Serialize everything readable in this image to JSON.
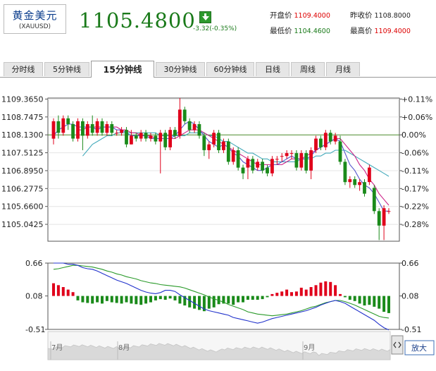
{
  "header": {
    "name": "黄金美元",
    "code": "(XAUUSD)",
    "price": "1105.4800",
    "change": "-3.32(-0.35%)",
    "stats": [
      {
        "label": "开盘价",
        "value": "1109.4000",
        "color": "#dd0000"
      },
      {
        "label": "昨收价",
        "value": "1108.8000",
        "color": "#222222"
      },
      {
        "label": "最低价",
        "value": "1104.4600",
        "color": "#1a7a1a"
      },
      {
        "label": "最高价",
        "value": "1109.4000",
        "color": "#dd0000"
      }
    ]
  },
  "tabs": [
    "分时线",
    "5分钟线",
    "15分钟线",
    "30分钟线",
    "60分钟线",
    "日线",
    "周线",
    "月线"
  ],
  "active_tab": "15分钟线",
  "colors": {
    "up": "#e0001b",
    "down": "#1a8a1a",
    "ma5": "#5555cc",
    "ma10": "#cc2288",
    "ma20": "#44aabb"
  },
  "chart_data": {
    "type": "candlestick",
    "y_ticks_left": [
      "1109.3650",
      "1108.7475",
      "1108.1300",
      "1107.5125",
      "1106.8950",
      "1106.2775",
      "1105.6600",
      "1105.0425"
    ],
    "y_ticks_right": [
      "+0.11%",
      "+0.06%",
      "0.00%",
      "-0.06%",
      "-0.11%",
      "-0.17%",
      "-0.22%",
      "-0.28%"
    ],
    "prev_close": 1108.13,
    "ylim": [
      1104.46,
      1109.4
    ],
    "candles": [
      [
        1108.0,
        1108.6,
        1108.7,
        1107.8
      ],
      [
        1108.6,
        1108.2,
        1108.8,
        1108.0
      ],
      [
        1108.2,
        1108.7,
        1108.8,
        1108.1
      ],
      [
        1108.7,
        1108.5,
        1108.8,
        1108.3
      ],
      [
        1108.5,
        1108.0,
        1108.6,
        1107.9
      ],
      [
        1108.0,
        1108.6,
        1108.7,
        1107.9
      ],
      [
        1108.6,
        1108.1,
        1108.7,
        1107.6
      ],
      [
        1108.1,
        1108.5,
        1108.6,
        1108.0
      ],
      [
        1108.5,
        1108.2,
        1108.8,
        1108.1
      ],
      [
        1108.2,
        1108.6,
        1108.7,
        1108.1
      ],
      [
        1108.6,
        1108.2,
        1108.7,
        1108.1
      ],
      [
        1108.2,
        1108.5,
        1108.6,
        1108.1
      ],
      [
        1108.5,
        1108.2,
        1108.6,
        1108.1
      ],
      [
        1108.2,
        1108.2,
        1108.3,
        1108.1
      ],
      [
        1108.2,
        1108.3,
        1108.4,
        1108.1
      ],
      [
        1108.3,
        1107.8,
        1108.4,
        1107.7
      ],
      [
        1107.8,
        1108.1,
        1108.3,
        1107.8
      ],
      [
        1108.1,
        1108.0,
        1108.2,
        1107.9
      ],
      [
        1108.0,
        1108.2,
        1108.3,
        1107.9
      ],
      [
        1108.2,
        1108.0,
        1108.3,
        1107.9
      ],
      [
        1108.0,
        1108.1,
        1108.2,
        1107.9
      ],
      [
        1108.1,
        1107.9,
        1108.2,
        1107.8
      ],
      [
        1107.9,
        1108.2,
        1108.3,
        1106.8
      ],
      [
        1108.2,
        1107.7,
        1108.3,
        1107.6
      ],
      [
        1107.7,
        1108.3,
        1108.4,
        1107.6
      ],
      [
        1108.3,
        1108.1,
        1108.4,
        1108.0
      ],
      [
        1108.1,
        1109.0,
        1109.4,
        1108.0
      ],
      [
        1109.0,
        1108.6,
        1109.1,
        1108.5
      ],
      [
        1108.6,
        1108.3,
        1108.7,
        1108.2
      ],
      [
        1108.3,
        1108.5,
        1108.6,
        1108.2
      ],
      [
        1108.5,
        1108.1,
        1108.6,
        1108.0
      ],
      [
        1108.1,
        1107.6,
        1108.2,
        1107.4
      ],
      [
        1107.6,
        1107.8,
        1107.9,
        1107.3
      ],
      [
        1107.8,
        1108.2,
        1108.3,
        1107.7
      ],
      [
        1108.2,
        1107.6,
        1108.3,
        1107.5
      ],
      [
        1107.6,
        1107.9,
        1108.0,
        1107.5
      ],
      [
        1107.9,
        1107.2,
        1108.0,
        1107.1
      ],
      [
        1107.2,
        1107.6,
        1107.7,
        1107.1
      ],
      [
        1107.6,
        1107.0,
        1107.7,
        1106.9
      ],
      [
        1107.0,
        1106.8,
        1107.1,
        1106.6
      ],
      [
        1107.0,
        1107.3,
        1107.4,
        1106.6
      ],
      [
        1107.3,
        1106.9,
        1107.4,
        1106.8
      ],
      [
        1107.0,
        1107.2,
        1107.3,
        1106.9
      ],
      [
        1107.2,
        1106.9,
        1107.3,
        1106.8
      ],
      [
        1107.0,
        1106.8,
        1107.1,
        1106.7
      ],
      [
        1106.8,
        1107.3,
        1107.4,
        1106.7
      ],
      [
        1107.3,
        1107.3,
        1107.4,
        1107.1
      ],
      [
        1107.4,
        1107.4,
        1107.5,
        1107.2
      ],
      [
        1107.4,
        1107.5,
        1107.6,
        1107.3
      ],
      [
        1107.5,
        1107.5,
        1107.6,
        1107.3
      ],
      [
        1107.5,
        1107.0,
        1107.6,
        1106.9
      ],
      [
        1107.0,
        1107.5,
        1107.6,
        1106.9
      ],
      [
        1107.5,
        1106.9,
        1107.6,
        1106.8
      ],
      [
        1106.9,
        1107.6,
        1107.7,
        1106.6
      ],
      [
        1107.6,
        1108.0,
        1108.1,
        1107.5
      ],
      [
        1108.0,
        1107.7,
        1108.1,
        1107.6
      ],
      [
        1107.7,
        1108.2,
        1108.3,
        1107.6
      ],
      [
        1108.2,
        1107.9,
        1108.3,
        1107.8
      ],
      [
        1107.9,
        1108.1,
        1108.2,
        1107.8
      ],
      [
        1107.9,
        1107.2,
        1108.1,
        1107.1
      ],
      [
        1107.2,
        1106.5,
        1107.3,
        1106.4
      ],
      [
        1106.5,
        1106.6,
        1106.7,
        1106.3
      ],
      [
        1106.6,
        1106.4,
        1106.7,
        1106.3
      ],
      [
        1106.4,
        1106.5,
        1106.6,
        1106.2
      ],
      [
        1106.5,
        1106.1,
        1106.6,
        1106.0
      ],
      [
        1106.5,
        1107.0,
        1107.1,
        1106.4
      ],
      [
        1106.3,
        1105.5,
        1106.4,
        1105.4
      ],
      [
        1105.5,
        1105.0,
        1105.6,
        1104.5
      ],
      [
        1105.0,
        1105.6,
        1105.7,
        1104.5
      ],
      [
        1105.5,
        1105.5,
        1105.6,
        1105.4
      ]
    ],
    "ma": {
      "ma5": [
        1108.1,
        1108.3,
        1108.4,
        1108.5,
        1108.5,
        1108.4,
        1108.4,
        1108.4,
        1108.4,
        1108.3,
        1108.4,
        1108.4,
        1108.4,
        1108.3,
        1108.3,
        1108.2,
        1108.1,
        1108.1,
        1108.1,
        1108.1,
        1108.0,
        1108.0,
        1108.0,
        1108.0,
        1108.0,
        1108.1,
        1108.3,
        1108.5,
        1108.6,
        1108.5,
        1108.3,
        1108.1,
        1107.9,
        1107.8,
        1107.7,
        1107.8,
        1107.7,
        1107.5,
        1107.4,
        1107.2,
        1107.1,
        1107.0,
        1106.9,
        1106.9,
        1107.0,
        1107.1,
        1107.1,
        1107.2,
        1107.3,
        1107.4,
        1107.3,
        1107.3,
        1107.3,
        1107.4,
        1107.6,
        1107.7,
        1107.8,
        1107.9,
        1108.0,
        1107.9,
        1107.5,
        1107.1,
        1106.9,
        1106.6,
        1106.4,
        1106.3,
        1106.1,
        1105.8,
        1105.5,
        1105.5
      ],
      "ma10": [
        null,
        null,
        null,
        null,
        null,
        1108.3,
        1108.3,
        1108.4,
        1108.4,
        1108.4,
        1108.4,
        1108.4,
        1108.4,
        1108.4,
        1108.3,
        1108.3,
        1108.2,
        1108.2,
        1108.1,
        1108.1,
        1108.1,
        1108.0,
        1108.0,
        1108.0,
        1108.0,
        1108.0,
        1108.1,
        1108.2,
        1108.3,
        1108.3,
        1108.3,
        1108.2,
        1108.1,
        1108.0,
        1107.9,
        1107.8,
        1107.7,
        1107.6,
        1107.5,
        1107.4,
        1107.3,
        1107.2,
        1107.1,
        1107.1,
        1107.1,
        1107.1,
        1107.1,
        1107.1,
        1107.2,
        1107.3,
        1107.3,
        1107.3,
        1107.4,
        1107.5,
        1107.6,
        1107.7,
        1107.8,
        1107.9,
        1108.0,
        1108.0,
        1107.8,
        1107.6,
        1107.4,
        1107.1,
        1106.9,
        1106.6,
        1106.4,
        1106.1,
        1105.9,
        1105.7
      ],
      "ma20": [
        null,
        null,
        null,
        null,
        null,
        null,
        1107.4,
        1107.6,
        1107.8,
        1107.9,
        1108.0,
        1108.1,
        1108.1,
        1108.2,
        1108.2,
        1108.2,
        1108.2,
        1108.2,
        1108.2,
        1108.2,
        1108.2,
        1108.2,
        1108.1,
        1108.1,
        1108.1,
        1108.1,
        1108.1,
        1108.1,
        1108.2,
        1108.2,
        1108.2,
        1108.2,
        1108.1,
        1108.1,
        1108.0,
        1107.9,
        1107.9,
        1107.8,
        1107.7,
        1107.6,
        1107.5,
        1107.5,
        1107.4,
        1107.3,
        1107.3,
        1107.2,
        1107.2,
        1107.2,
        1107.2,
        1107.2,
        1107.2,
        1107.3,
        1107.3,
        1107.3,
        1107.4,
        1107.4,
        1107.5,
        1107.5,
        1107.6,
        1107.6,
        1107.6,
        1107.5,
        1107.4,
        1107.3,
        1107.2,
        1107.1,
        1107.0,
        1106.9,
        1106.8,
        1106.7
      ]
    },
    "macd": {
      "y_ticks": [
        "0.66",
        "0.08",
        "-0.51"
      ],
      "ylim": [
        -0.51,
        0.66
      ],
      "hist": [
        0.2,
        0.17,
        0.14,
        0.1,
        0.06,
        -0.07,
        -0.1,
        -0.11,
        -0.12,
        -0.1,
        -0.12,
        -0.08,
        -0.1,
        -0.11,
        -0.12,
        -0.1,
        -0.12,
        -0.13,
        -0.14,
        -0.12,
        -0.1,
        -0.07,
        -0.05,
        -0.06,
        -0.04,
        -0.07,
        -0.12,
        -0.15,
        -0.18,
        -0.2,
        -0.22,
        -0.24,
        -0.2,
        -0.18,
        -0.13,
        -0.12,
        -0.12,
        -0.14,
        -0.1,
        -0.1,
        -0.06,
        -0.06,
        -0.06,
        -0.05,
        -0.02,
        0.03,
        0.05,
        0.07,
        0.1,
        0.06,
        0.07,
        0.13,
        0.1,
        0.14,
        0.17,
        0.21,
        0.23,
        0.22,
        0.17,
        0.03,
        -0.02,
        -0.06,
        -0.08,
        -0.12,
        -0.15,
        -0.14,
        -0.17,
        -0.2,
        -0.25,
        -0.27
      ],
      "dif": [
        0.66,
        0.66,
        0.66,
        0.64,
        0.64,
        0.62,
        0.58,
        0.56,
        0.55,
        0.52,
        0.48,
        0.44,
        0.4,
        0.36,
        0.33,
        0.3,
        0.26,
        0.22,
        0.18,
        0.15,
        0.13,
        0.12,
        0.14,
        0.18,
        0.18,
        0.16,
        0.1,
        0.05,
        0.0,
        -0.05,
        -0.1,
        -0.15,
        -0.18,
        -0.2,
        -0.22,
        -0.24,
        -0.26,
        -0.3,
        -0.32,
        -0.34,
        -0.36,
        -0.38,
        -0.4,
        -0.38,
        -0.35,
        -0.32,
        -0.3,
        -0.28,
        -0.26,
        -0.24,
        -0.22,
        -0.2,
        -0.18,
        -0.15,
        -0.12,
        -0.08,
        -0.05,
        -0.02,
        0.0,
        -0.02,
        -0.05,
        -0.1,
        -0.15,
        -0.2,
        -0.25,
        -0.3,
        -0.35,
        -0.42,
        -0.48,
        -0.52
      ],
      "dea": [
        0.55,
        0.56,
        0.58,
        0.6,
        0.62,
        0.62,
        0.61,
        0.6,
        0.59,
        0.57,
        0.55,
        0.52,
        0.5,
        0.47,
        0.45,
        0.42,
        0.4,
        0.38,
        0.35,
        0.33,
        0.31,
        0.3,
        0.28,
        0.27,
        0.26,
        0.25,
        0.24,
        0.22,
        0.19,
        0.16,
        0.13,
        0.1,
        0.06,
        0.03,
        0.0,
        -0.03,
        -0.07,
        -0.1,
        -0.13,
        -0.16,
        -0.2,
        -0.22,
        -0.24,
        -0.25,
        -0.26,
        -0.27,
        -0.26,
        -0.25,
        -0.24,
        -0.22,
        -0.2,
        -0.18,
        -0.15,
        -0.12,
        -0.1,
        -0.07,
        -0.04,
        -0.02,
        0.0,
        0.0,
        -0.02,
        -0.05,
        -0.08,
        -0.12,
        -0.16,
        -0.2,
        -0.24,
        -0.28,
        -0.3,
        -0.31
      ]
    },
    "navigator": {
      "labels": [
        "7月",
        "8月",
        "9月"
      ],
      "button": "放大"
    }
  }
}
